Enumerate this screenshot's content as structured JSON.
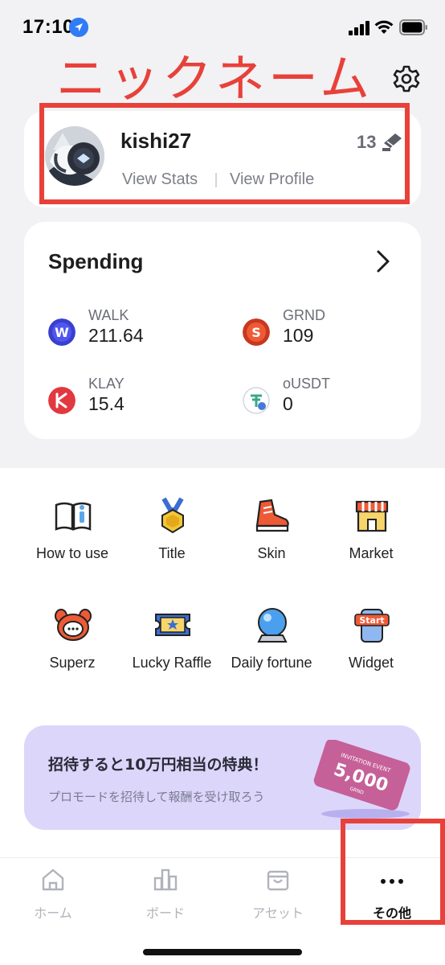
{
  "status_bar": {
    "time": "17:10"
  },
  "annotation": {
    "nickname_label": "ニックネーム"
  },
  "profile": {
    "username": "kishi27",
    "level": "13",
    "view_stats": "View Stats",
    "view_profile": "View Profile"
  },
  "spending": {
    "title": "Spending",
    "tokens": [
      {
        "name": "WALK",
        "value": "211.64",
        "color": "#3a3fcf"
      },
      {
        "name": "GRND",
        "value": "109",
        "color": "#e2512f"
      },
      {
        "name": "KLAY",
        "value": "15.4",
        "color": "#e2383f"
      },
      {
        "name": "oUSDT",
        "value": "0",
        "color": "#3aa78a"
      }
    ]
  },
  "menu": {
    "items": [
      {
        "label": "How to use",
        "icon": "book-icon"
      },
      {
        "label": "Title",
        "icon": "medal-icon"
      },
      {
        "label": "Skin",
        "icon": "sneaker-icon"
      },
      {
        "label": "Market",
        "icon": "shop-icon"
      },
      {
        "label": "Superz",
        "icon": "superz-icon"
      },
      {
        "label": "Lucky Raffle",
        "icon": "ticket-icon"
      },
      {
        "label": "Daily fortune",
        "icon": "crystal-ball-icon"
      },
      {
        "label": "Widget",
        "icon": "phone-widget-icon"
      }
    ]
  },
  "banner": {
    "title": "招待すると10万円相当の特典！",
    "subtitle": "プロモードを招待して報酬を受け取ろう",
    "ticket_top": "INVITATION EVENT",
    "ticket_amount": "5,000",
    "ticket_unit": "GRND"
  },
  "tabbar": {
    "tabs": [
      {
        "label": "ホーム"
      },
      {
        "label": "ボード"
      },
      {
        "label": "アセット"
      },
      {
        "label": "その他"
      }
    ]
  }
}
